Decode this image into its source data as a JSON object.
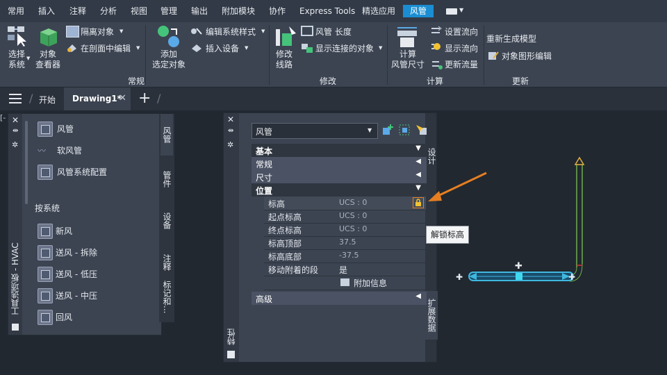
{
  "menu": {
    "tabs": [
      "常用",
      "插入",
      "注释",
      "分析",
      "视图",
      "管理",
      "输出",
      "附加模块",
      "协作",
      "Express Tools",
      "精选应用",
      "风管"
    ],
    "active": "风管"
  },
  "ribbon": {
    "select_system": "选择\n系统",
    "object_viewer": "对象\n查看器",
    "isolate_objects": "隔离对象",
    "edit_in_section": "在剖面中编辑",
    "add_selected": "添加\n选定对象",
    "edit_system_style": "编辑系统样式",
    "insert_equipment": "插入设备",
    "group_general": "常规",
    "modify_route": "修改\n线路",
    "duct_length": "风管 长度",
    "show_connected": "显示连接的对象",
    "group_modify": "修改",
    "calc_duct_size": "计算\n风管尺寸",
    "set_flow": "设置流向",
    "show_flow": "显示流向",
    "update_flow": "更新流量",
    "group_calc": "计算",
    "regen_model": "重新生成模型",
    "object_graphic_edit": "对象图形编辑",
    "group_update": "更新"
  },
  "doctabs": {
    "start": "开始",
    "drawing": "Drawing1*"
  },
  "tool_palette": {
    "title": "工具选项板 - HVAC",
    "items_top": [
      "风管",
      "软风管",
      "风管系统配置"
    ],
    "section": "按系统",
    "items_system": [
      "新风",
      "送风 - 拆除",
      "送风 - 低压",
      "送风 - 中压",
      "回风"
    ],
    "vtabs": [
      "风管",
      "管件",
      "设备",
      "注释",
      "标记和..."
    ]
  },
  "properties": {
    "title": "特性",
    "dropdown": "风管",
    "tabs_right": [
      "设计",
      "扩展数据"
    ],
    "sections": {
      "basic": "基本",
      "general": "常规",
      "dimensions": "尺寸",
      "location": "位置",
      "advanced": "高级"
    },
    "rows": [
      {
        "label": "标高",
        "value": "UCS : 0"
      },
      {
        "label": "起点标高",
        "value": "UCS : 0"
      },
      {
        "label": "终点标高",
        "value": "UCS : 0"
      },
      {
        "label": "标高顶部",
        "value": "37.5"
      },
      {
        "label": "标高底部",
        "value": "-37.5"
      },
      {
        "label": "移动附着的段",
        "value": "是"
      }
    ],
    "additional_info": "附加信息",
    "tooltip": "解锁标高"
  },
  "colors": {
    "accent": "#1b8dd2",
    "arrow": "#e67e22",
    "duct": "#3fb8e0"
  }
}
